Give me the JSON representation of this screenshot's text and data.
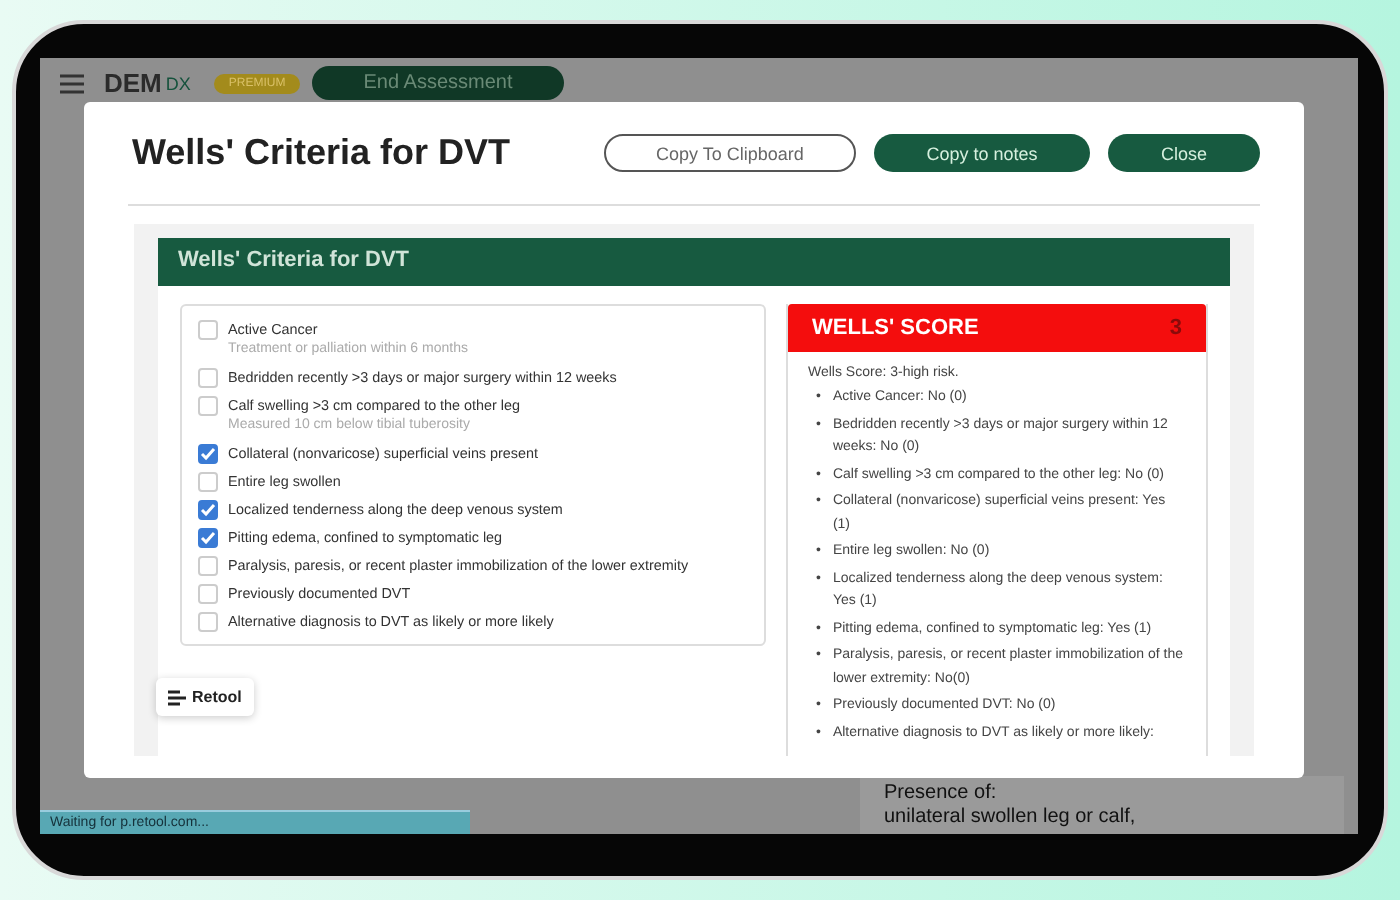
{
  "app_bar": {
    "logo": "DEM",
    "logo_suffix": "DX",
    "badge": "PREMIUM",
    "end_button": "End Assessment"
  },
  "background_panel": {
    "heading": "Presence of:",
    "line": "unilateral swollen leg or calf,"
  },
  "modal": {
    "title": "Wells' Criteria for DVT",
    "buttons": [
      {
        "label": "Copy To Clipboard",
        "kind": "outline"
      },
      {
        "label": "Copy to notes",
        "kind": "filled"
      },
      {
        "label": "Close",
        "kind": "filled"
      }
    ],
    "section_title": "Wells' Criteria for DVT",
    "criteria": [
      {
        "label": "Active Cancer",
        "note": "Treatment or palliation within 6 months",
        "checked": false
      },
      {
        "label": "Bedridden recently >3 days or major surgery within 12 weeks",
        "checked": false
      },
      {
        "label": "Calf swelling >3 cm compared to the other leg",
        "note": "Measured 10 cm below tibial tuberosity",
        "checked": false
      },
      {
        "label": "Collateral (nonvaricose) superficial veins present",
        "checked": true
      },
      {
        "label": "Entire leg swollen",
        "checked": false
      },
      {
        "label": "Localized tenderness along the deep venous system",
        "checked": true
      },
      {
        "label": "Pitting edema, confined to symptomatic leg",
        "checked": true
      },
      {
        "label": "Paralysis, paresis, or recent plaster immobilization of the lower extremity",
        "checked": false
      },
      {
        "label": "Previously documented DVT",
        "checked": false
      },
      {
        "label": "Alternative diagnosis to DVT as likely or more likely",
        "checked": false
      }
    ],
    "score": {
      "title": "WELLS' SCORE",
      "value": "3",
      "bullet": "•",
      "summary": "Wells Score: 3-high risk.",
      "items": [
        "Active Cancer: No (0)",
        "Bedridden recently >3 days or major surgery within 12 weeks: No (0)",
        "Calf swelling >3 cm compared to the other leg: No (0)",
        "Collateral (nonvaricose) superficial veins present: Yes (1)",
        "Entire leg swollen: No (0)",
        "Localized tenderness along the deep venous system: Yes (1)",
        "Pitting edema, confined to symptomatic leg: Yes (1)",
        "Paralysis, paresis, or recent plaster immobilization of the lower extremity: No(0)",
        "Previously documented DVT: No (0)",
        "Alternative diagnosis to DVT as likely or more likely:"
      ]
    },
    "retool_badge": "Retool"
  },
  "status_bar": "Waiting for p.retool.com..."
}
